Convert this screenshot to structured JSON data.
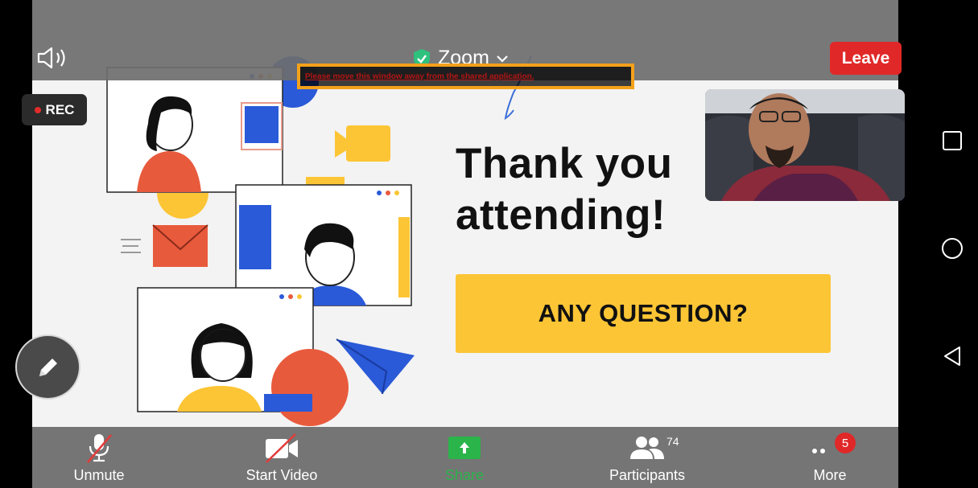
{
  "meeting": {
    "title": "Zoom",
    "leave_label": "Leave",
    "rec_label": "REC",
    "share_warning": "Please move this window away from the shared application."
  },
  "slide": {
    "title": "Thank you attending!",
    "button": "ANY QUESTION?"
  },
  "toolbar": {
    "unmute_label": "Unmute",
    "start_video_label": "Start Video",
    "share_label": "Share",
    "participants_label": "Participants",
    "participants_count": "74",
    "more_label": "More",
    "more_badge": "5"
  },
  "colors": {
    "leave": "#e02828",
    "share": "#2ab44a",
    "slide_accent": "#fcc535",
    "warning_border": "#f4a11a",
    "shield": "#2ec27e"
  },
  "icons": [
    "speaker-icon",
    "shield-check-icon",
    "chevron-down-icon",
    "pencil-icon",
    "mic-muted-icon",
    "video-off-icon",
    "share-arrow-icon",
    "participants-icon",
    "more-dots-icon",
    "square-nav-icon",
    "circle-nav-icon",
    "back-triangle-icon"
  ]
}
